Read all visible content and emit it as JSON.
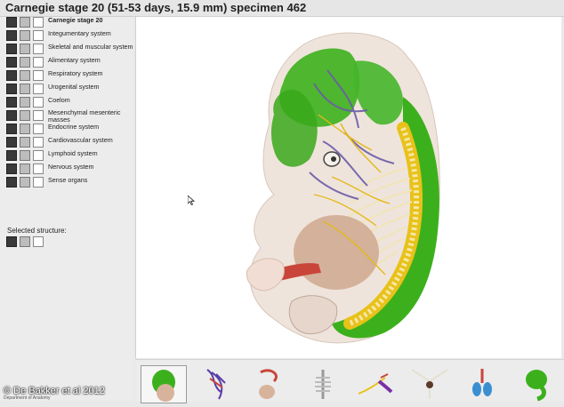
{
  "window": {
    "title": "Carnegie stage 20 (51-53 days, 15.9 mm) specimen 462"
  },
  "sidebar": {
    "items": [
      {
        "label": "Carnegie stage 20",
        "bold": true
      },
      {
        "label": "Integumentary system"
      },
      {
        "label": "Skeletal and muscular system"
      },
      {
        "label": "Alimentary system"
      },
      {
        "label": "Respiratory system"
      },
      {
        "label": "Urogenital system"
      },
      {
        "label": "Coelom"
      },
      {
        "label": "Mesenchymal mesenteric masses"
      },
      {
        "label": "Endocrine system"
      },
      {
        "label": "Cardiovascular system"
      },
      {
        "label": "Lymphoid system"
      },
      {
        "label": "Nervous system"
      },
      {
        "label": "Sense organs"
      }
    ],
    "selected_label": "Selected structure:"
  },
  "thumbnails": [
    {
      "name": "embryo-thumb",
      "active": true
    },
    {
      "name": "vascular-thumb"
    },
    {
      "name": "gut-thumb"
    },
    {
      "name": "skeleton-thumb"
    },
    {
      "name": "vessels-thumb"
    },
    {
      "name": "nerves-thumb"
    },
    {
      "name": "heart-thumb"
    },
    {
      "name": "brain-thumb"
    }
  ],
  "overlay": {
    "credit": "© De Bakker et al 2012",
    "dept": "Department of Anatomy"
  },
  "colors": {
    "green": "#3cb01c",
    "yellow": "#e8c21a",
    "purple": "#6c5ca8",
    "red": "#c9453a",
    "skin": "#d9b9a4"
  }
}
